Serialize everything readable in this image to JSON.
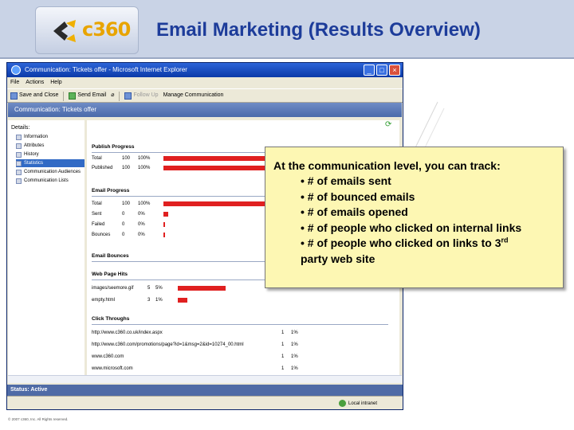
{
  "slide": {
    "title": "Email Marketing (Results Overview)",
    "logo_text": "c360",
    "footer": "© 2007 c360, Inc. All Rights reserved."
  },
  "window": {
    "title": "Communication: Tickets offer - Microsoft Internet Explorer",
    "menu": [
      "File",
      "Actions",
      "Help"
    ],
    "toolbar": [
      "Save and Close",
      "Send Email",
      "Follow Up",
      "Manage Communication"
    ],
    "page_header": "Communication: Tickets offer",
    "status_bar": "Status: Active",
    "zone": "Local intranet"
  },
  "nav": {
    "root": "Details:",
    "items": [
      "Information",
      "Attributes",
      "History",
      "Statistics",
      "Communication Audiences",
      "Communication Lists"
    ],
    "selected_index": 3
  },
  "publish_progress": {
    "title": "Publish Progress",
    "rows": [
      {
        "label": "Total",
        "count": "100",
        "pct": "100%",
        "fraction": 1.0
      },
      {
        "label": "Published",
        "count": "100",
        "pct": "100%",
        "fraction": 1.0
      }
    ]
  },
  "email_progress": {
    "title": "Email Progress",
    "rows": [
      {
        "label": "Total",
        "count": "100",
        "pct": "100%",
        "fraction": 1.0
      },
      {
        "label": "Sent",
        "count": "0",
        "pct": "0%",
        "fraction": 0.0
      },
      {
        "label": "Failed",
        "count": "0",
        "pct": "0%",
        "fraction": 0.0
      },
      {
        "label": "Bounces",
        "count": "0",
        "pct": "0%",
        "fraction": 0.0
      }
    ]
  },
  "email_bounces": {
    "title": "Email Bounces"
  },
  "web_page_hits": {
    "title": "Web Page Hits",
    "rows": [
      {
        "label": "images/seemore.gif",
        "count": "5",
        "pct": "5%",
        "fraction": 0.05
      },
      {
        "label": "empty.html",
        "count": "3",
        "pct": "1%",
        "fraction": 0.01
      }
    ]
  },
  "click_throughs": {
    "title": "Click Throughs",
    "rows": [
      {
        "url": "http://www.c360.co.uk/index.aspx",
        "count": "1",
        "pct": "1%"
      },
      {
        "url": "http://www.c360.com/promotions/page?id=1&msg=2&id=10274_00.html",
        "count": "1",
        "pct": "1%"
      },
      {
        "url": "www.c360.com",
        "count": "1",
        "pct": "1%"
      },
      {
        "url": "www.microsoft.com",
        "count": "1",
        "pct": "1%"
      }
    ]
  },
  "callout": {
    "lead": "At the communication level, you can track:",
    "items": [
      "• # of emails sent",
      "• # of bounced emails",
      "• # of emails opened",
      "• # of people who clicked on internal links",
      "• # of people who clicked on links to 3"
    ],
    "superscript": "rd",
    "last_line": "party web site"
  },
  "colors": {
    "title": "#1d3c9a",
    "bar": "#e02020",
    "callout_bg": "#fdf7b3",
    "header_band": "#c9d3e6"
  }
}
